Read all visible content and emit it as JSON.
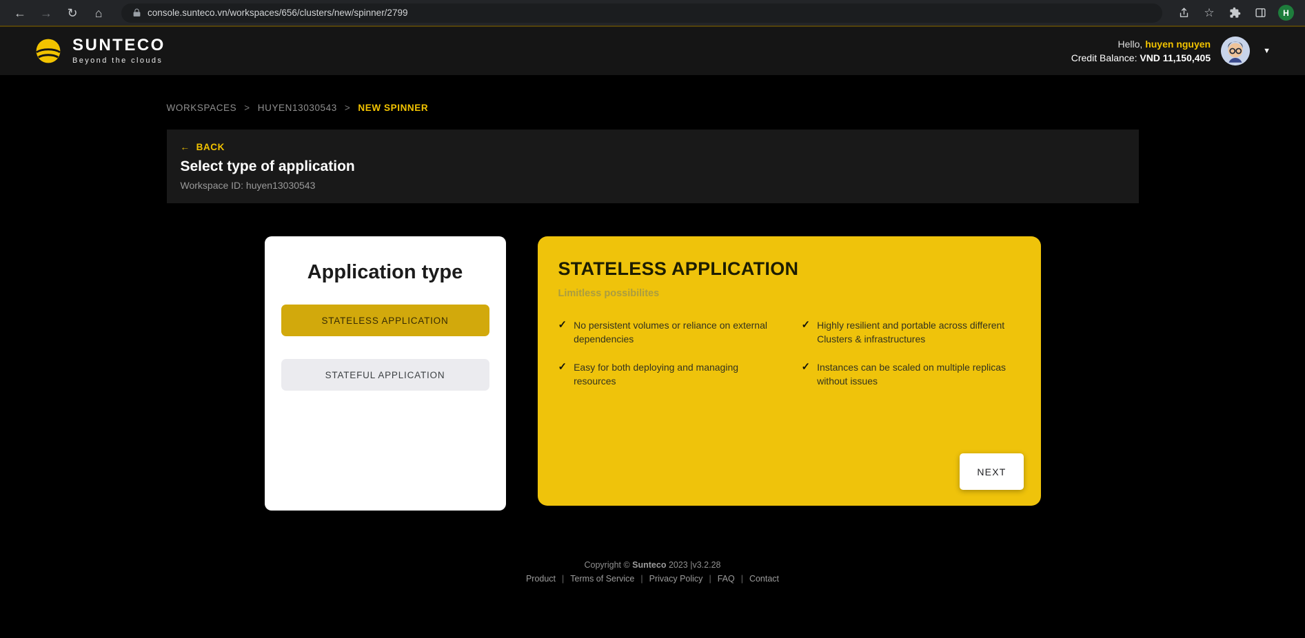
{
  "browser": {
    "url": "console.sunteco.vn/workspaces/656/clusters/new/spinner/2799",
    "profile_initial": "H"
  },
  "icons": {
    "back": "←",
    "forward": "→",
    "reload": "↻",
    "home": "⌂",
    "star": "☆",
    "chevron_down": "▼",
    "check": "✓"
  },
  "header": {
    "logo_title": "SUNTECO",
    "logo_subtitle": "Beyond the clouds",
    "greeting_prefix": "Hello, ",
    "username": "huyen nguyen",
    "credit_label": "Credit Balance: ",
    "credit_value": "VND 11,150,405"
  },
  "breadcrumb": {
    "separator": ">",
    "items": [
      {
        "label": "WORKSPACES"
      },
      {
        "label": "HUYEN13030543"
      },
      {
        "label": "NEW SPINNER"
      }
    ]
  },
  "page": {
    "back_arrow": "←",
    "back_label": "BACK",
    "title": "Select type of application",
    "workspace_id": "Workspace ID: huyen13030543"
  },
  "selector": {
    "title": "Application type",
    "options": [
      {
        "label": "STATELESS APPLICATION",
        "active": true
      },
      {
        "label": "STATEFUL APPLICATION",
        "active": false
      }
    ]
  },
  "detail": {
    "title": "STATELESS APPLICATION",
    "subtitle": "Limitless possibilites",
    "features": [
      "No persistent volumes or reliance on external dependencies",
      "Easy for both deploying and managing resources",
      "Highly resilient and portable across different Clusters & infrastructures",
      "Instances can be scaled on multiple replicas without issues"
    ],
    "next_label": "NEXT"
  },
  "footer": {
    "copyright_prefix": "Copyright © ",
    "brand": "Sunteco",
    "year_version": " 2023  |v3.2.28",
    "separator": "|",
    "links": [
      {
        "label": "Product"
      },
      {
        "label": "Terms of Service"
      },
      {
        "label": "Privacy Policy"
      },
      {
        "label": "FAQ"
      },
      {
        "label": "Contact"
      }
    ]
  },
  "colors": {
    "accent": "#F2C300",
    "card_yellow": "#EFC30B",
    "active_button": "#D2A90C"
  }
}
